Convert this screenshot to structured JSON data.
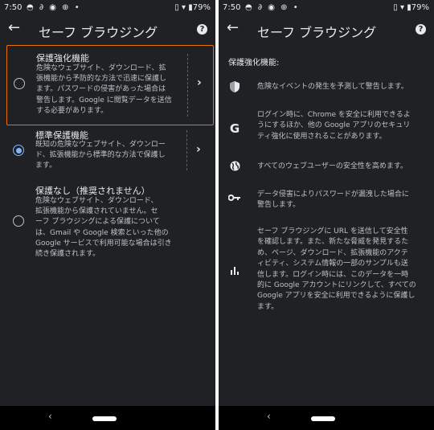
{
  "status_bar": {
    "time": "7:50",
    "battery": "79%"
  },
  "left": {
    "title": "セーフ ブラウジング",
    "options": [
      {
        "title": "保護強化機能",
        "description": [
          "危険なウェブサイト、ダウンロード、拡",
          "張機能から予防的な方法で迅速に保護し",
          "ます。パスワードの侵害があった場合は",
          "警告します。Google に閲覧データを送信",
          "する必要があります。"
        ],
        "selected": false
      },
      {
        "title": "標準保護機能",
        "description": [
          "既知の危険なウェブサイト、ダウンロー",
          "ド、拡張機能から標準的な方法で保護し",
          "ます。"
        ],
        "selected": true
      },
      {
        "title": "保護なし（推奨されません）",
        "description": [
          "危険なウェブサイト、ダウンロード、",
          "拡張機能から保護されていません。セ",
          "ーフ ブラウジングによる保護について",
          "は、Gmail や Google 検索といった他の",
          "Google サービスで利用可能な場合は引き",
          "続き保護されます。"
        ],
        "selected": false
      }
    ]
  },
  "right": {
    "title": "セーフ ブラウジング",
    "section_title": "保護強化機能:",
    "features": [
      {
        "icon": "shield-icon",
        "text": [
          "危険なイベントの発生を予測して警告します。"
        ]
      },
      {
        "icon": "google-g-icon",
        "text": [
          "ログイン時に、Chrome を安全に利用できるよ",
          "うにするほか、他の Google アプリのセキュリ",
          "ティ強化に使用されることがあります。"
        ]
      },
      {
        "icon": "globe-icon",
        "text": [
          "すべてのウェブユーザーの安全性を高めます。"
        ]
      },
      {
        "icon": "key-icon",
        "text": [
          "データ侵害によりパスワードが漏洩した場合に",
          "警告します。"
        ]
      },
      {
        "icon": "bar-chart-icon",
        "text": [
          "セーフ ブラウジングに URL を送信して安全性",
          "を確認します。また、新たな脅威を発見するた",
          "め、ページ、ダウンロード、拡張機能のアクテ",
          "ィビティ、システム情報の一部のサンプルも送",
          "信します。ログイン時には、このデータを一時",
          "的に Google アカウントにリンクして、すべての",
          "Google アプリを安全に利用できるように保護し",
          "ます。"
        ]
      }
    ]
  }
}
